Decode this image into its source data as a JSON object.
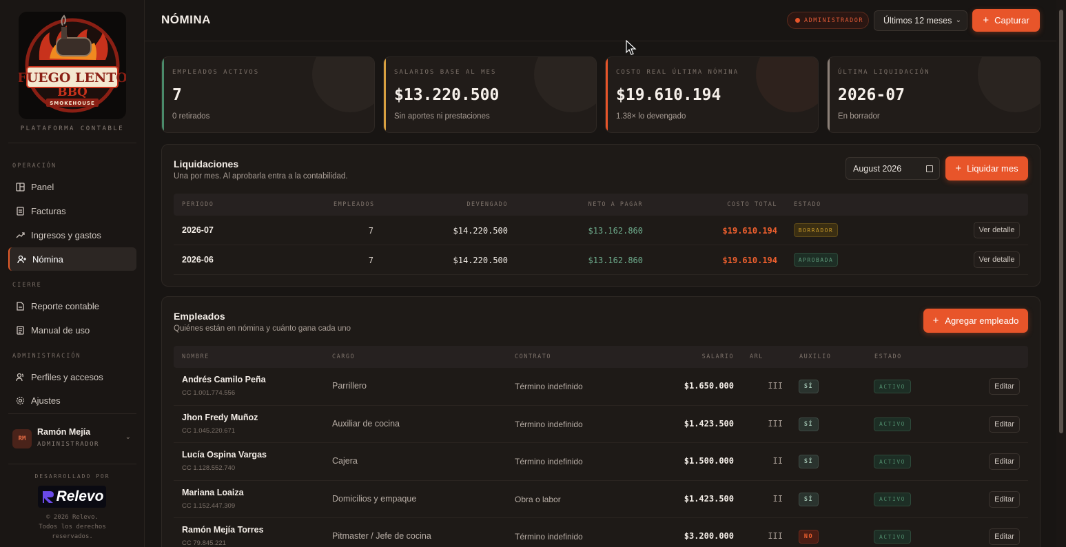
{
  "brand": {
    "logo_text_1": "FUEGO LENTO",
    "logo_text_2": "BBQ",
    "logo_text_3": "SMOKEHOUSE",
    "platform": "PLATAFORMA CONTABLE"
  },
  "sidebar": {
    "sections": [
      {
        "label": "OPERACIÓN"
      },
      {
        "label": "CIERRE"
      },
      {
        "label": "ADMINISTRACIÓN"
      }
    ],
    "items": [
      {
        "label": "Panel",
        "icon": "grid-icon"
      },
      {
        "label": "Facturas",
        "icon": "receipt-icon"
      },
      {
        "label": "Ingresos y gastos",
        "icon": "trend-icon"
      },
      {
        "label": "Nómina",
        "icon": "user-plus-icon",
        "active": true
      },
      {
        "label": "Reporte contable",
        "icon": "file-icon"
      },
      {
        "label": "Manual de uso",
        "icon": "book-icon"
      },
      {
        "label": "Perfiles y accesos",
        "icon": "users-icon"
      },
      {
        "label": "Ajustes",
        "icon": "gear-icon"
      }
    ],
    "user": {
      "initials": "RM",
      "name": "Ramón Mejía",
      "role": "ADMINISTRADOR"
    },
    "developed_by": "DESARROLLADO POR",
    "dev_logo": "Relevo",
    "copyright_1": "© 2026 Relevo.",
    "copyright_2": "Todos los derechos",
    "copyright_3": "reservados."
  },
  "header": {
    "title": "NÓMINA",
    "role_badge": "ADMINISTRADOR",
    "period": "Últimos 12 meses",
    "capture_button": "Capturar"
  },
  "stats": [
    {
      "label": "EMPLEADOS ACTIVOS",
      "value": "7",
      "sub": "0 retirados",
      "color": "#4a8a6a"
    },
    {
      "label": "SALARIOS BASE AL MES",
      "value": "$13.220.500",
      "sub": "Sin aportes ni prestaciones",
      "color": "#d8a040"
    },
    {
      "label": "COSTO REAL ÚLTIMA NÓMINA",
      "value": "$19.610.194",
      "sub": "1.38× lo devengado",
      "color": "#e8552a"
    },
    {
      "label": "ÚLTIMA LIQUIDACIÓN",
      "value": "2026-07",
      "sub": "En borrador",
      "color": "#8a7f77"
    }
  ],
  "liquidaciones": {
    "title": "Liquidaciones",
    "subtitle": "Una por mes. Al aprobarla entra a la contabilidad.",
    "month_value": "August 2026",
    "button": "Liquidar mes",
    "columns": [
      "PERIODO",
      "EMPLEADOS",
      "DEVENGADO",
      "NETO A PAGAR",
      "COSTO TOTAL",
      "ESTADO"
    ],
    "rows": [
      {
        "periodo": "2026-07",
        "empleados": "7",
        "devengado": "$14.220.500",
        "neto": "$13.162.860",
        "costo": "$19.610.194",
        "estado": "BORRADOR",
        "action": "Ver detalle"
      },
      {
        "periodo": "2026-06",
        "empleados": "7",
        "devengado": "$14.220.500",
        "neto": "$13.162.860",
        "costo": "$19.610.194",
        "estado": "APROBADA",
        "action": "Ver detalle"
      }
    ]
  },
  "empleados": {
    "title": "Empleados",
    "subtitle": "Quiénes están en nómina y cuánto gana cada uno",
    "button": "Agregar empleado",
    "columns": [
      "NOMBRE",
      "CARGO",
      "CONTRATO",
      "SALARIO",
      "ARL",
      "AUXILIO",
      "ESTADO"
    ],
    "rows": [
      {
        "nombre": "Andrés Camilo Peña",
        "cc": "CC 1.001.774.556",
        "cargo": "Parrillero",
        "contrato": "Término indefinido",
        "salario": "$1.650.000",
        "arl": "III",
        "auxilio": "SÍ",
        "estado": "ACTIVO",
        "action": "Editar"
      },
      {
        "nombre": "Jhon Fredy Muñoz",
        "cc": "CC 1.045.220.671",
        "cargo": "Auxiliar de cocina",
        "contrato": "Término indefinido",
        "salario": "$1.423.500",
        "arl": "III",
        "auxilio": "SÍ",
        "estado": "ACTIVO",
        "action": "Editar"
      },
      {
        "nombre": "Lucía Ospina Vargas",
        "cc": "CC 1.128.552.740",
        "cargo": "Cajera",
        "contrato": "Término indefinido",
        "salario": "$1.500.000",
        "arl": "II",
        "auxilio": "SÍ",
        "estado": "ACTIVO",
        "action": "Editar"
      },
      {
        "nombre": "Mariana Loaiza",
        "cc": "CC 1.152.447.309",
        "cargo": "Domicilios y empaque",
        "contrato": "Obra o labor",
        "salario": "$1.423.500",
        "arl": "II",
        "auxilio": "SÍ",
        "estado": "ACTIVO",
        "action": "Editar"
      },
      {
        "nombre": "Ramón Mejía Torres",
        "cc": "CC 79.845.221",
        "cargo": "Pitmaster / Jefe de cocina",
        "contrato": "Término indefinido",
        "salario": "$3.200.000",
        "arl": "III",
        "auxilio": "NO",
        "estado": "ACTIVO",
        "action": "Editar"
      }
    ]
  },
  "colors": {
    "accent": "#e8552a",
    "bg": "#181513",
    "positive": "#6fae8e",
    "negative": "#f0602e"
  }
}
